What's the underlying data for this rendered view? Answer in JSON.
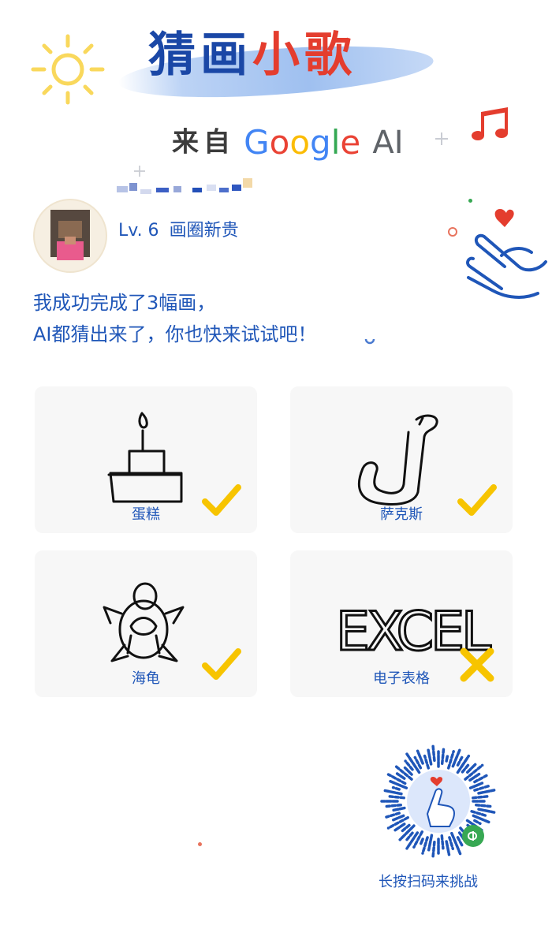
{
  "header": {
    "title_part1": "猜画",
    "title_part2": "小歌",
    "from_label": "来自",
    "google_letters": [
      "G",
      "o",
      "o",
      "g",
      "l",
      "e"
    ],
    "google_colors": [
      "#4285f4",
      "#ea4335",
      "#fbbc05",
      "#4285f4",
      "#34a853",
      "#ea4335"
    ],
    "ai_label": "AI"
  },
  "user": {
    "level": "Lv. 6",
    "rank": "画圈新贵"
  },
  "message": {
    "line1": "我成功完成了3幅画，",
    "line2": "AI都猜出来了，你也快来试试吧！"
  },
  "drawings": [
    {
      "label": "蛋糕",
      "result": "correct",
      "icon": "cake-sketch"
    },
    {
      "label": "萨克斯",
      "result": "correct",
      "icon": "saxophone-sketch"
    },
    {
      "label": "海龟",
      "result": "correct",
      "icon": "turtle-sketch"
    },
    {
      "label": "电子表格",
      "result": "wrong",
      "icon": "excel-sketch"
    }
  ],
  "drawing_texts": {
    "excel": "EXCEL"
  },
  "footer": {
    "qr_caption": "长按扫码来挑战"
  },
  "colors": {
    "brand_blue": "#1f56b8",
    "check_yellow": "#f7c400",
    "title_red": "#e43d2e"
  }
}
